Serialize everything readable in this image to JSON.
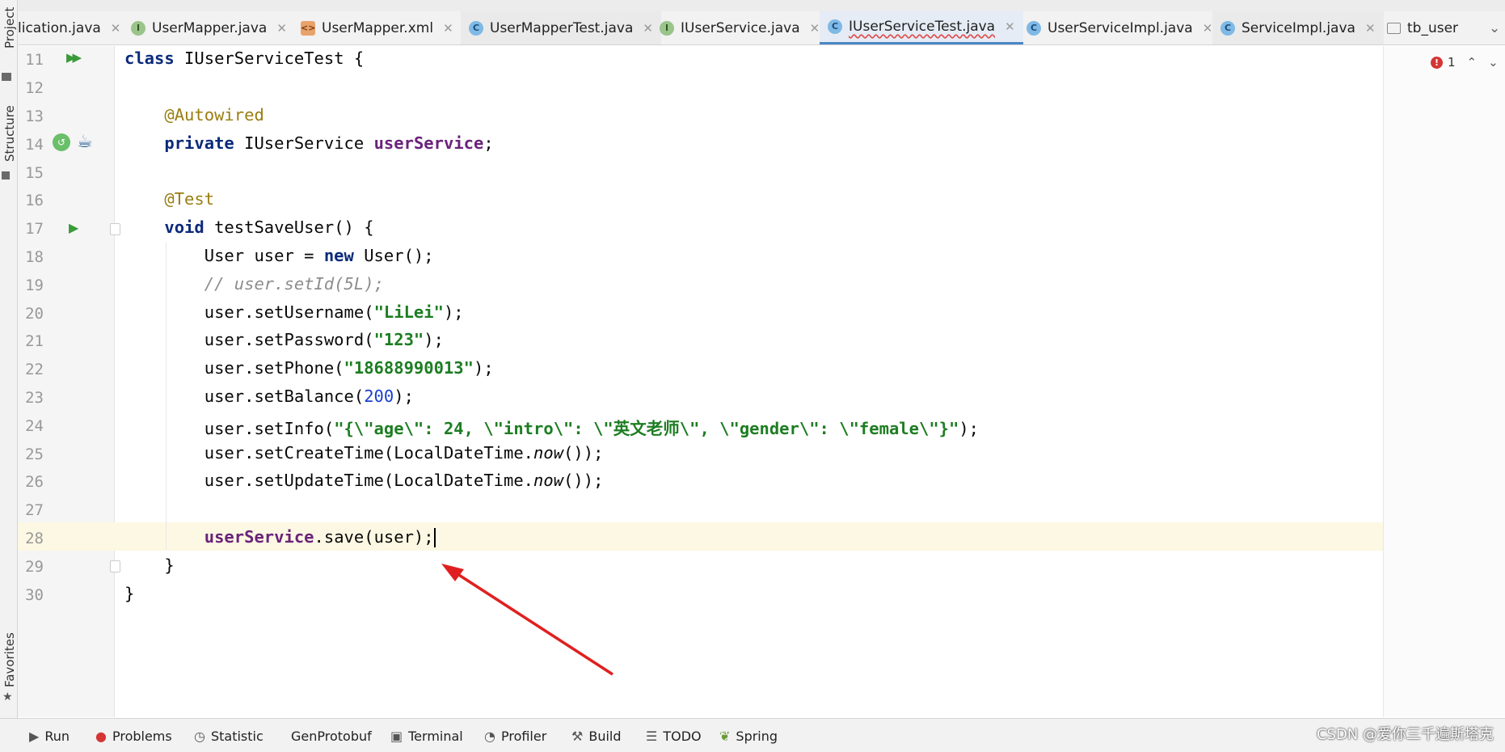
{
  "tabs": [
    {
      "label": "lication.java",
      "icon": "",
      "active": false
    },
    {
      "label": "UserMapper.java",
      "icon": "I",
      "active": false
    },
    {
      "label": "UserMapper.xml",
      "icon": "x",
      "active": false
    },
    {
      "label": "UserMapperTest.java",
      "icon": "C",
      "active": false
    },
    {
      "label": "IUserService.java",
      "icon": "I",
      "active": false
    },
    {
      "label": "IUserServiceTest.java",
      "icon": "C",
      "active": true
    },
    {
      "label": "UserServiceImpl.java",
      "icon": "C",
      "active": false
    },
    {
      "label": "ServiceImpl.java",
      "icon": "C",
      "active": false
    },
    {
      "label": "tb_user",
      "icon": "table",
      "active": false
    }
  ],
  "left_strip": {
    "project": "Project",
    "structure": "Structure",
    "favorites": "Favorites"
  },
  "line_numbers": [
    "11",
    "12",
    "13",
    "14",
    "15",
    "16",
    "17",
    "18",
    "19",
    "20",
    "21",
    "22",
    "23",
    "24",
    "25",
    "26",
    "27",
    "28",
    "29",
    "30"
  ],
  "error_count": "1",
  "bottom_tools": [
    "Run",
    "Problems",
    "Statistic",
    "GenProtobuf",
    "Terminal",
    "Profiler",
    "Build",
    "TODO",
    "Spring"
  ],
  "watermark": "CSDN @爱你三千遍斯塔克",
  "colors": {
    "accent": "#4a86c6",
    "keyword": "#0b2a7a",
    "string": "#1d7d22",
    "annotation": "#9a7e10",
    "field": "#6a237a",
    "arrow": "#e02020"
  }
}
